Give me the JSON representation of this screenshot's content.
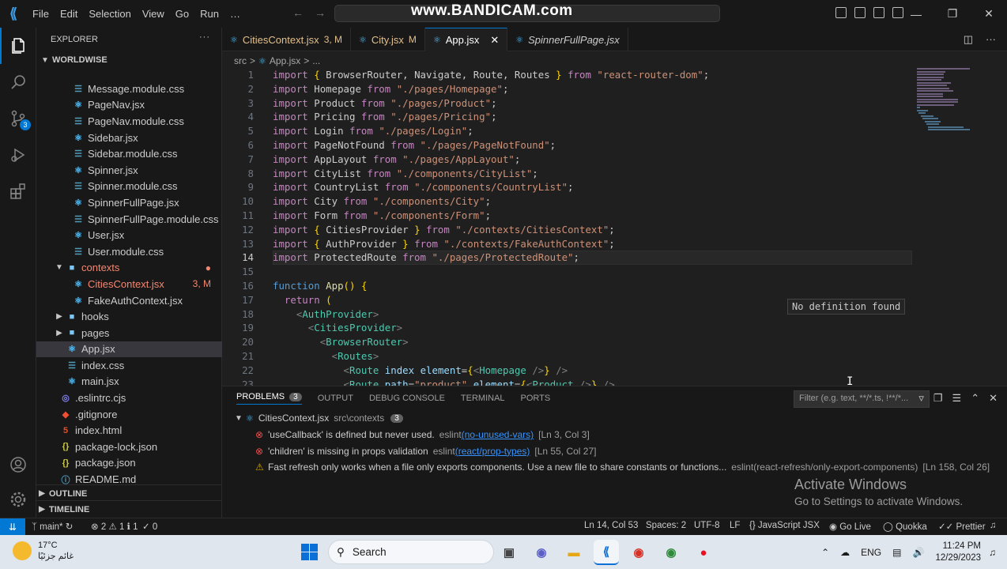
{
  "titlebar": {
    "menu": [
      "File",
      "Edit",
      "Selection",
      "View",
      "Go",
      "Run",
      "…"
    ],
    "watermark": "www.BANDICAM.com"
  },
  "activitybar": {
    "scm_badge": "3"
  },
  "sidebar": {
    "title": "EXPLORER",
    "workspace": "WORLDWISE",
    "files": [
      {
        "name": "Message.module.css",
        "type": "css",
        "indent": 2
      },
      {
        "name": "PageNav.jsx",
        "type": "jsx",
        "indent": 2
      },
      {
        "name": "PageNav.module.css",
        "type": "css",
        "indent": 2
      },
      {
        "name": "Sidebar.jsx",
        "type": "jsx",
        "indent": 2
      },
      {
        "name": "Sidebar.module.css",
        "type": "css",
        "indent": 2
      },
      {
        "name": "Spinner.jsx",
        "type": "jsx",
        "indent": 2
      },
      {
        "name": "Spinner.module.css",
        "type": "css",
        "indent": 2
      },
      {
        "name": "SpinnerFullPage.jsx",
        "type": "jsx",
        "indent": 2
      },
      {
        "name": "SpinnerFullPage.module.css",
        "type": "css",
        "indent": 2
      },
      {
        "name": "User.jsx",
        "type": "jsx",
        "indent": 2
      },
      {
        "name": "User.module.css",
        "type": "css",
        "indent": 2
      }
    ],
    "contexts_folder": "contexts",
    "cities_context": "CitiesContext.jsx",
    "cities_context_status": "3, M",
    "fake_auth": "FakeAuthContext.jsx",
    "hooks_folder": "hooks",
    "pages_folder": "pages",
    "app_jsx": "App.jsx",
    "index_css": "index.css",
    "main_jsx": "main.jsx",
    "root_files": [
      {
        "name": ".eslintrc.cjs",
        "type": "eslint"
      },
      {
        "name": ".gitignore",
        "type": "git"
      },
      {
        "name": "index.html",
        "type": "html"
      },
      {
        "name": "package-lock.json",
        "type": "json"
      },
      {
        "name": "package.json",
        "type": "json"
      },
      {
        "name": "README.md",
        "type": "md"
      }
    ],
    "outline": "OUTLINE",
    "timeline": "TIMELINE"
  },
  "tabs": [
    {
      "label": "CitiesContext.jsx",
      "status": "3, M",
      "modified": true
    },
    {
      "label": "City.jsx",
      "status": "M",
      "modified": true
    },
    {
      "label": "App.jsx",
      "status": "",
      "active": true
    },
    {
      "label": "SpinnerFullPage.jsx",
      "status": "",
      "preview": true
    }
  ],
  "breadcrumb": {
    "folder": "src",
    "sep": ">",
    "file": "App.jsx",
    "more": "..."
  },
  "editor": {
    "current_line": 14,
    "lines": [
      "import { BrowserRouter, Navigate, Route, Routes } from \"react-router-dom\";",
      "import Homepage from \"./pages/Homepage\";",
      "import Product from \"./pages/Product\";",
      "import Pricing from \"./pages/Pricing\";",
      "import Login from \"./pages/Login\";",
      "import PageNotFound from \"./pages/PageNotFound\";",
      "import AppLayout from \"./pages/AppLayout\";",
      "import CityList from \"./components/CityList\";",
      "import CountryList from \"./components/CountryList\";",
      "import City from \"./components/City\";",
      "import Form from \"./components/Form\";",
      "import { CitiesProvider } from \"./contexts/CitiesContext\";",
      "import { AuthProvider } from \"./contexts/FakeAuthContext\";",
      "import ProtectedRoute from \"./pages/ProtectedRoute\";",
      "",
      "function App() {",
      "  return (",
      "    <AuthProvider>",
      "      <CitiesProvider>",
      "        <BrowserRouter>",
      "          <Routes>",
      "            <Route index element={<Homepage />} />",
      "            <Route path=\"product\" element={<Product />} />"
    ],
    "tooltip": "No definition found"
  },
  "panel": {
    "tabs": [
      {
        "label": "PROBLEMS",
        "badge": "3",
        "active": true
      },
      {
        "label": "OUTPUT"
      },
      {
        "label": "DEBUG CONSOLE"
      },
      {
        "label": "TERMINAL"
      },
      {
        "label": "PORTS"
      }
    ],
    "filter_placeholder": "Filter (e.g. text, **/*.ts, !**/*...",
    "group": {
      "file": "CitiesContext.jsx",
      "path": "src\\contexts",
      "count": "3"
    },
    "problems": [
      {
        "severity": "error",
        "message": "'useCallback' is defined but never used.",
        "source": "eslint",
        "rule": "(no-unused-vars)",
        "loc": "[Ln 3, Col 3]"
      },
      {
        "severity": "error",
        "message": "'children' is missing in props validation",
        "source": "eslint",
        "rule": "(react/prop-types)",
        "loc": "[Ln 55, Col 27]"
      },
      {
        "severity": "warning",
        "message": "Fast refresh only works when a file only exports components. Use a new file to share constants or functions...",
        "source": "eslint(react-refresh/only-export-components)",
        "rule": "",
        "loc": "[Ln 158, Col 26]"
      }
    ]
  },
  "activate_windows": {
    "title": "Activate Windows",
    "subtitle": "Go to Settings to activate Windows."
  },
  "statusbar": {
    "branch": "main*",
    "errors": "2",
    "warnings": "1",
    "info": "1",
    "ports": "0",
    "position": "Ln 14, Col 53",
    "spaces": "Spaces: 2",
    "encoding": "UTF-8",
    "eol": "LF",
    "language": "JavaScript JSX",
    "golive": "Go Live",
    "quokka": "Quokka",
    "prettier": "Prettier"
  },
  "taskbar": {
    "temp": "17°C",
    "weather_text": "غائم جزئيًا",
    "search": "Search",
    "lang": "ENG",
    "time": "11:24 PM",
    "date": "12/29/2023"
  }
}
